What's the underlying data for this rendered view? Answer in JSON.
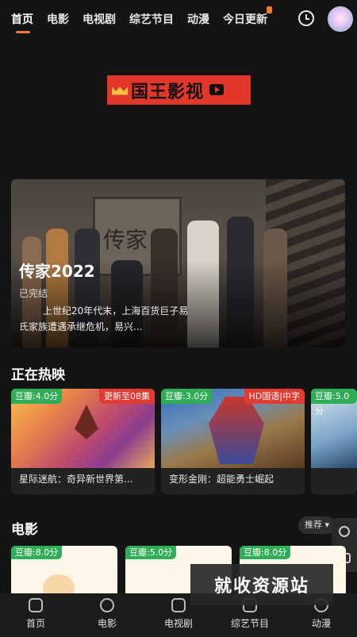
{
  "nav": {
    "tabs": [
      "首页",
      "电影",
      "电视剧",
      "综艺节目",
      "动漫",
      "今日更新"
    ],
    "active": "首页"
  },
  "logo": {
    "text": "国王影视"
  },
  "banner": {
    "sign_text": "传家",
    "title": "传家2022",
    "status": "已完结",
    "description": "上世纪20年代末，上海百货巨子易氏家族遭遇承继危机，易兴..."
  },
  "now_showing": {
    "title": "正在热映",
    "cards": [
      {
        "score": "豆瓣:4.0分",
        "tag": "更新至08集",
        "name": "星际迷航：奇异新世界第..."
      },
      {
        "score": "豆瓣:3.0分",
        "tag": "HD国语|中字",
        "name": "变形金刚：超能勇士崛起"
      },
      {
        "score": "豆瓣:5.0分",
        "tag": "",
        "name": ""
      }
    ]
  },
  "movies": {
    "title": "电影",
    "sort_label": "推荐",
    "cards": [
      {
        "score": "豆瓣:8.0分"
      },
      {
        "score": "豆瓣:5.0分"
      },
      {
        "score": "豆瓣:8.0分"
      }
    ]
  },
  "watermark": "就收资源站",
  "bottom_nav": [
    "首页",
    "电影",
    "电视剧",
    "综艺节目",
    "动漫"
  ],
  "colors": {
    "accent": "#f07a2a",
    "score_green": "#2fae57",
    "tag_red": "#e23b33",
    "logo_red": "#e3372c"
  }
}
